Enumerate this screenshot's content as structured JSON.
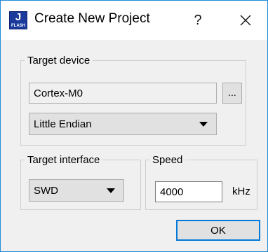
{
  "window": {
    "title": "Create New Project",
    "help_label": "?",
    "icon": {
      "name": "jflash-app-icon",
      "letter": "J",
      "caption": "FLASH"
    }
  },
  "target_device": {
    "legend": "Target device",
    "device_value": "Cortex-M0",
    "browse_label": "...",
    "endian_value": "Little Endian"
  },
  "target_interface": {
    "legend": "Target interface",
    "value": "SWD"
  },
  "speed": {
    "legend": "Speed",
    "value": "4000",
    "unit": "kHz"
  },
  "buttons": {
    "ok": "OK"
  },
  "colors": {
    "accent": "#0078d7",
    "window_border": "#1f8ad8",
    "dialog_bg": "#f0f0f0"
  }
}
